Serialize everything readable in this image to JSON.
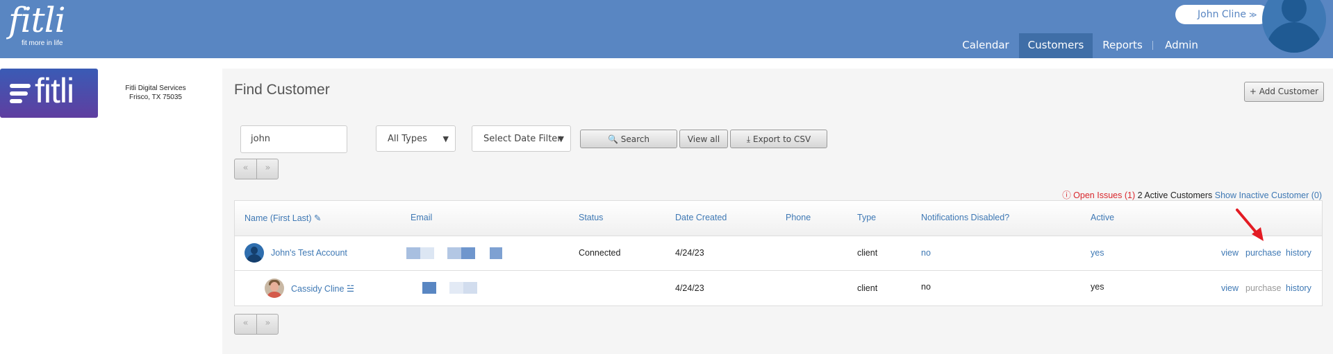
{
  "header": {
    "logo_text": "fitli",
    "logo_tagline": "fit more in life",
    "user_name": "John Cline",
    "nav": [
      "Calendar",
      "Customers",
      "Reports",
      "Admin"
    ],
    "active_nav": "Customers"
  },
  "business": {
    "logo_text": "fitli",
    "name": "Fitli Digital Services",
    "location": "Frisco, TX 75035"
  },
  "page": {
    "title": "Find Customer",
    "add_button": "+ Add Customer"
  },
  "filters": {
    "search_value": "john",
    "type_select": "All Types",
    "date_select": "Select Date Filter",
    "search_button": "Search",
    "view_all_button": "View all",
    "export_button": "Export to CSV",
    "pager_prev": "«",
    "pager_next": "»"
  },
  "summary": {
    "open_issues": "Open Issues (1)",
    "active_count": "2 Active Customers",
    "show_inactive": "Show Inactive Customer (0)"
  },
  "table": {
    "columns": [
      "Name (First Last)",
      "Email",
      "Status",
      "Date Created",
      "Phone",
      "Type",
      "Notifications Disabled?",
      "Active"
    ],
    "rows": [
      {
        "name": "John's Test Account",
        "status": "Connected",
        "date_created": "4/24/23",
        "phone": "",
        "type": "client",
        "notifications_disabled": "no",
        "active": "yes",
        "actions": [
          "view",
          "purchase",
          "history"
        ]
      },
      {
        "name": "Cassidy Cline",
        "status": "",
        "date_created": "4/24/23",
        "phone": "",
        "type": "client",
        "notifications_disabled": "no",
        "active": "yes",
        "actions": [
          "view",
          "purchase",
          "history"
        ]
      }
    ]
  },
  "colors": {
    "header_bg": "#5986c2",
    "nav_active_bg": "#3f6ea7",
    "link": "#3e78b4",
    "alert_red": "#d9262c",
    "panel_bg": "#f5f5f5"
  }
}
